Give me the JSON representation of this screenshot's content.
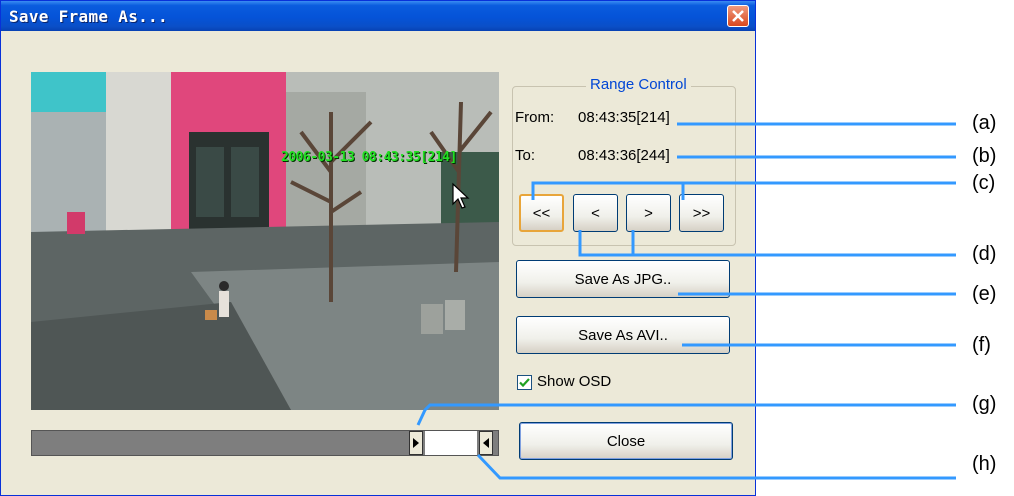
{
  "window": {
    "title": "Save Frame As..."
  },
  "video": {
    "osd_text": "2006-03-13 08:43:35[214]"
  },
  "range_control": {
    "title": "Range Control",
    "from_label": "From:",
    "from_value": "08:43:35[214]",
    "to_label": "To:",
    "to_value": "08:43:36[244]",
    "nav_buttons": [
      "<<",
      "<",
      ">",
      ">>"
    ]
  },
  "buttons": {
    "save_jpg": "Save As JPG..",
    "save_avi": "Save As AVI..",
    "close": "Close"
  },
  "options": {
    "show_osd_label": "Show OSD",
    "show_osd_checked": true
  },
  "callouts": [
    "(a)",
    "(b)",
    "(c)",
    "(d)",
    "(e)",
    "(f)",
    "(g)",
    "(h)"
  ],
  "colors": {
    "title_bar": "#0553D8",
    "osd_text": "#22E022",
    "callout_line": "#3399FF",
    "group_title": "#0046D5"
  },
  "icons": {
    "close": "close-icon",
    "cursor": "mouse-pointer-icon",
    "checkbox": "checkmark-icon",
    "slider_start": "play-right-icon",
    "slider_end": "play-left-icon"
  }
}
